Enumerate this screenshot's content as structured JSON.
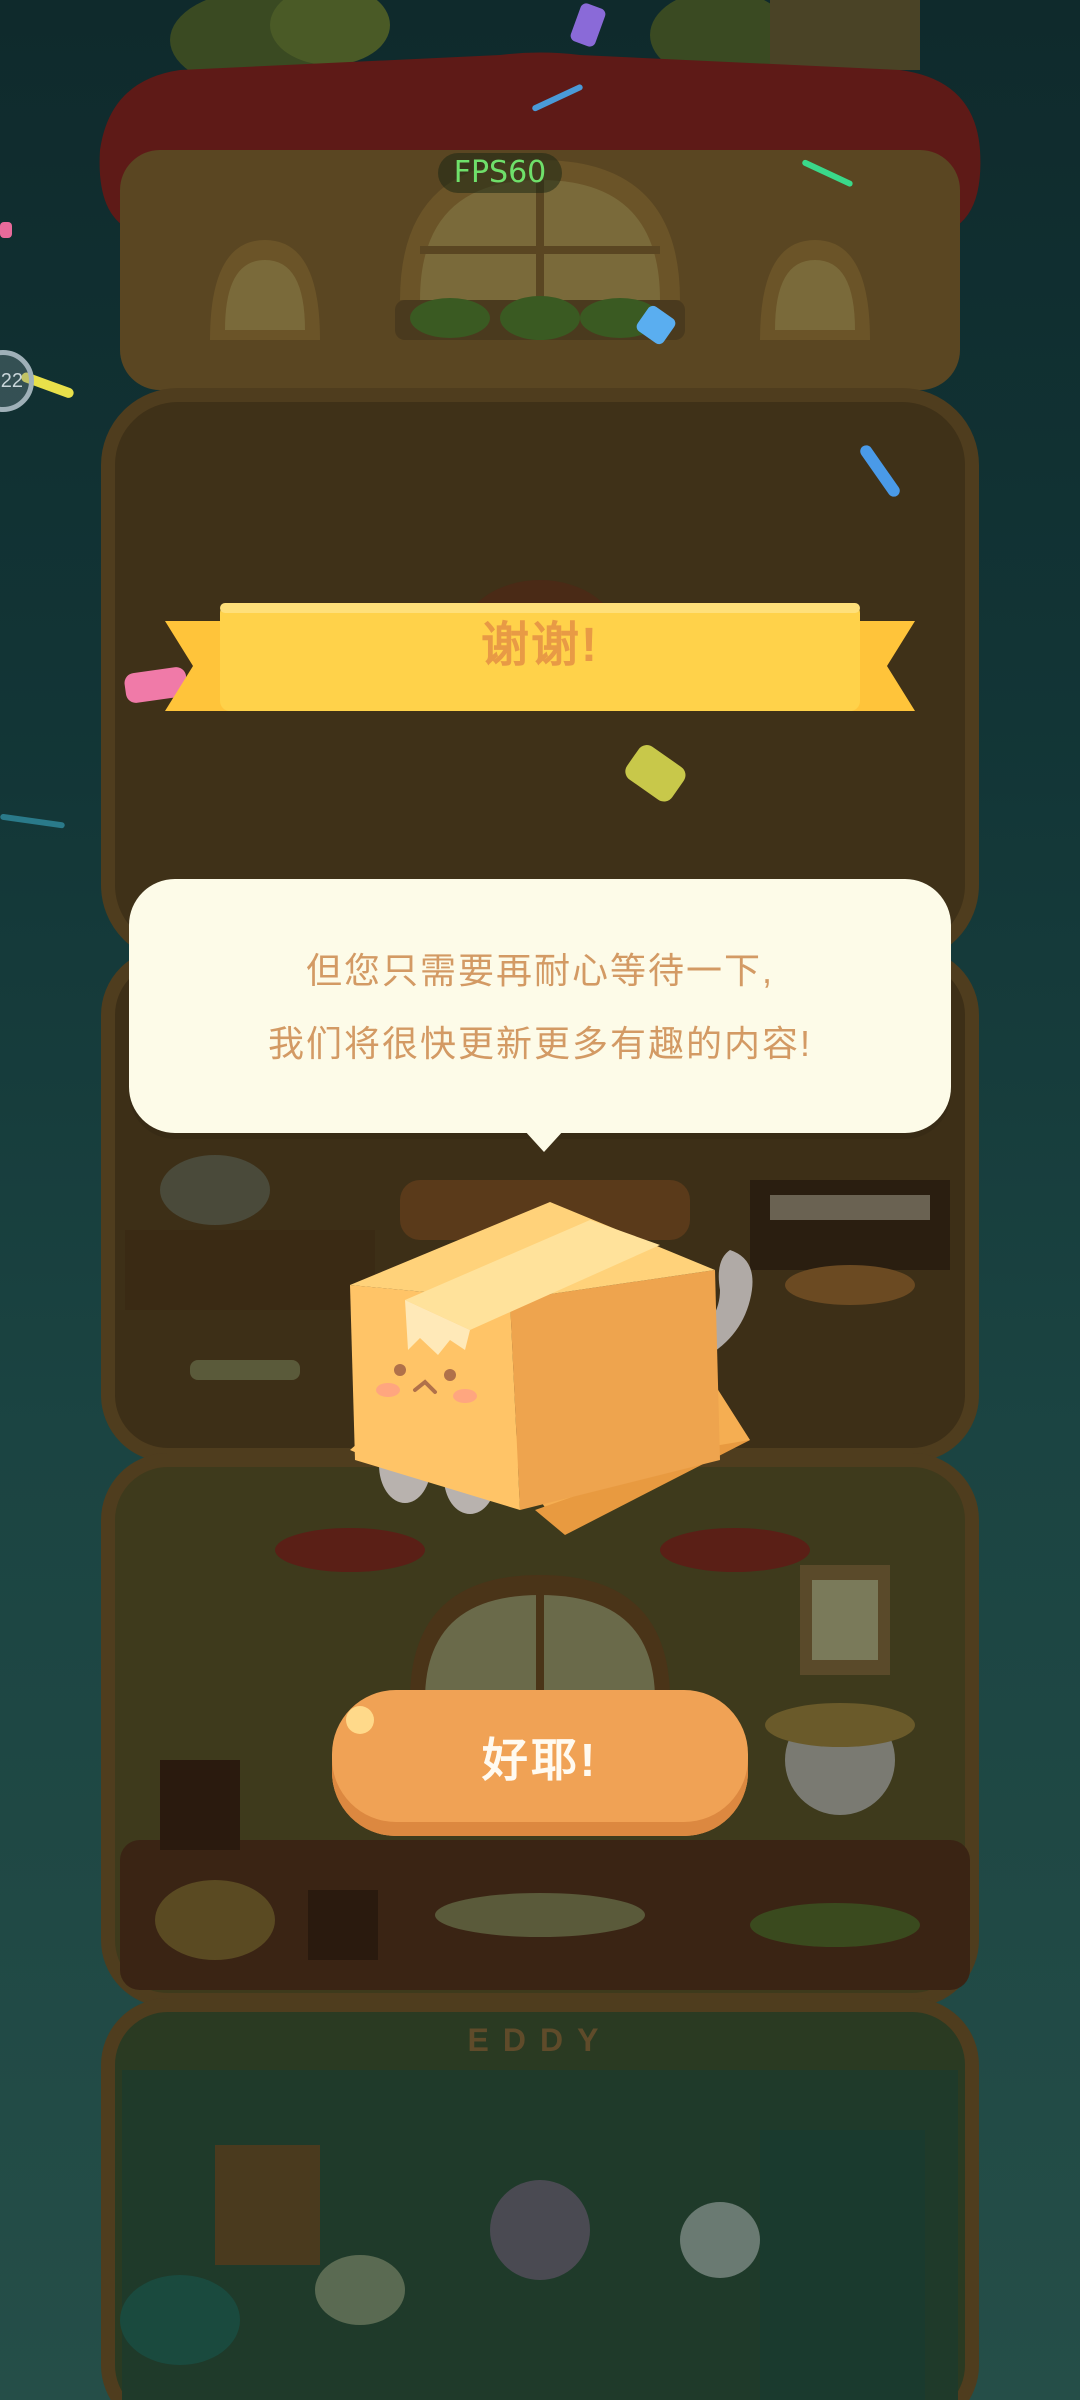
{
  "hud": {
    "fps": "FPS60"
  },
  "banner": {
    "title": "谢谢!"
  },
  "message": {
    "line1": "但您只需要再耐心等待一下,",
    "line2": "我们将很快更新更多有趣的内容!"
  },
  "button": {
    "label": "好耶!"
  },
  "floor_sign": {
    "text": "EDDY"
  },
  "colors": {
    "banner": "#ffd24a",
    "banner_text": "#e89a45",
    "bubble": "#fdfbe8",
    "bubble_text": "#d39a64",
    "button": "#f0a255",
    "fps_text": "#6fe06a"
  },
  "icons": [
    "cardboard-box-cat",
    "confetti"
  ]
}
